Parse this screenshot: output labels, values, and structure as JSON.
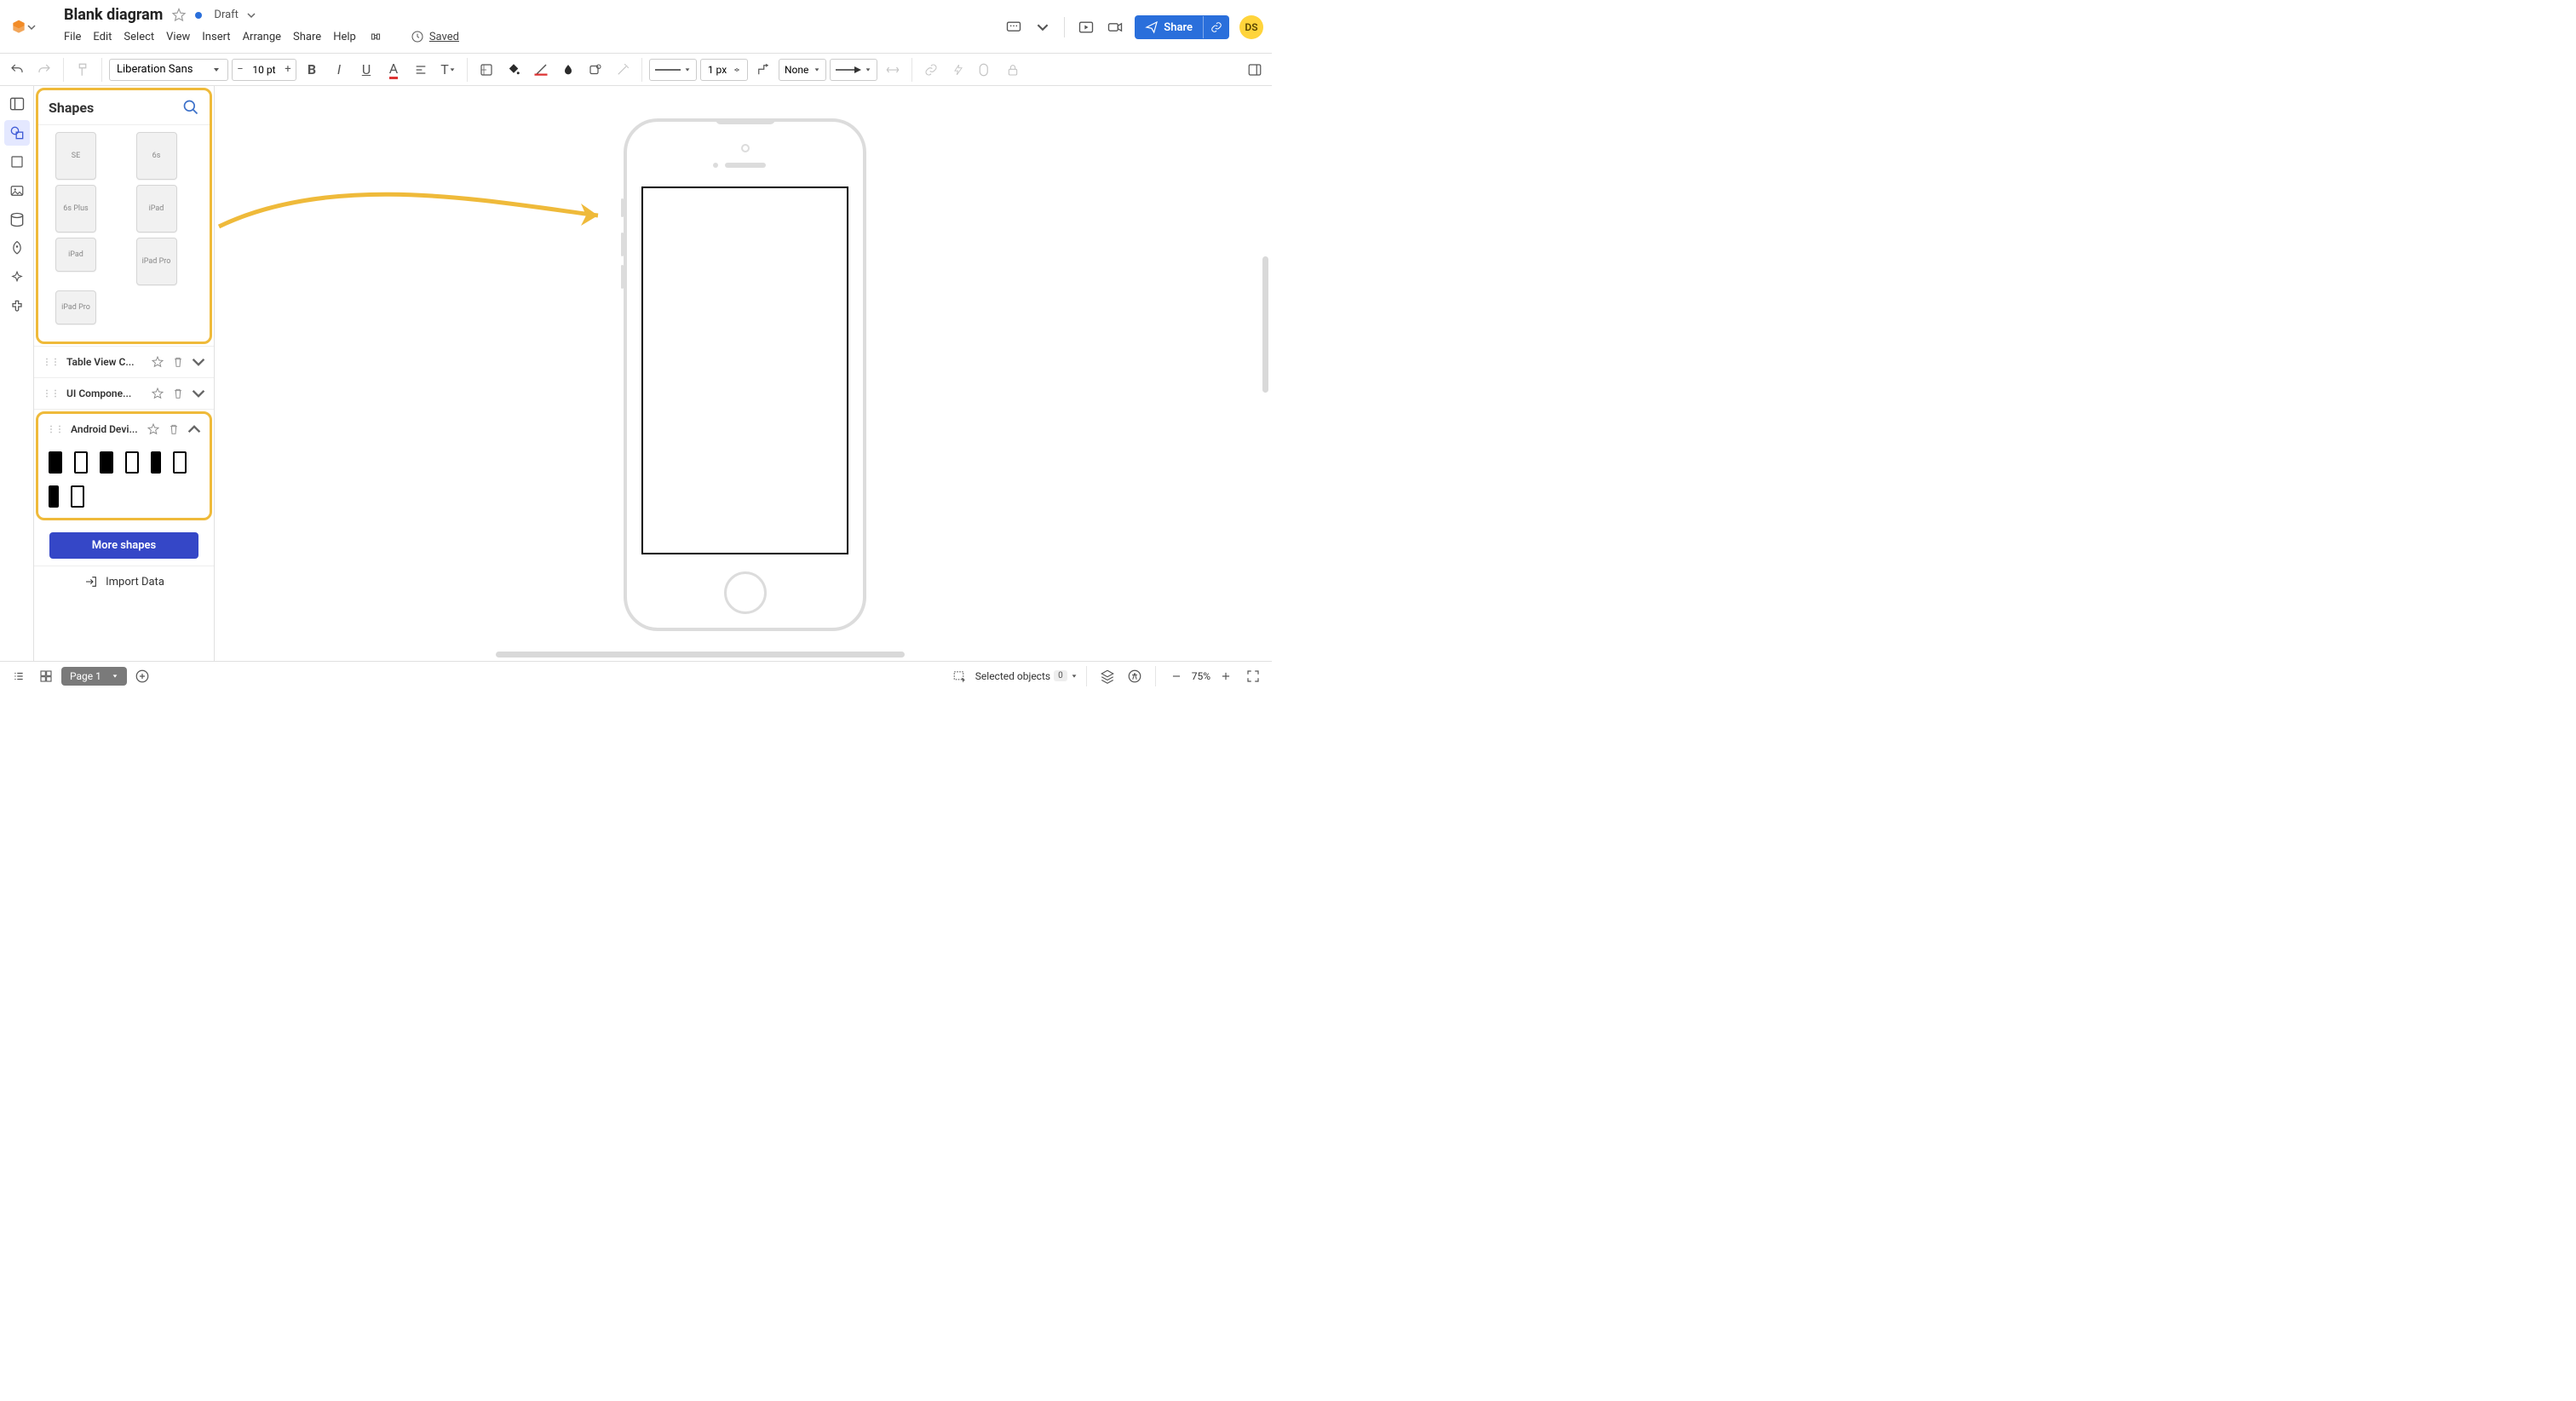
{
  "header": {
    "title": "Blank diagram",
    "status_label": "Draft",
    "avatar": "DS",
    "share_label": "Share",
    "saved_label": "Saved",
    "menu": [
      "File",
      "Edit",
      "Select",
      "View",
      "Insert",
      "Arrange",
      "Share",
      "Help"
    ]
  },
  "toolbar": {
    "font": "Liberation Sans",
    "size": "10 pt",
    "line_end": "None",
    "line_width": "1 px"
  },
  "panel": {
    "title": "Shapes",
    "devices": [
      "SE",
      "6s",
      "6s Plus",
      "iPad",
      "iPad",
      "iPad Pro",
      "iPad Pro"
    ],
    "groups": {
      "tableview": "Table View C...",
      "uicomp": "UI Compone...",
      "android": "Android Devi..."
    },
    "more": "More shapes",
    "import": "Import Data"
  },
  "footer": {
    "page": "Page 1",
    "selected_label": "Selected objects",
    "selected_count": "0",
    "zoom": "75%"
  }
}
